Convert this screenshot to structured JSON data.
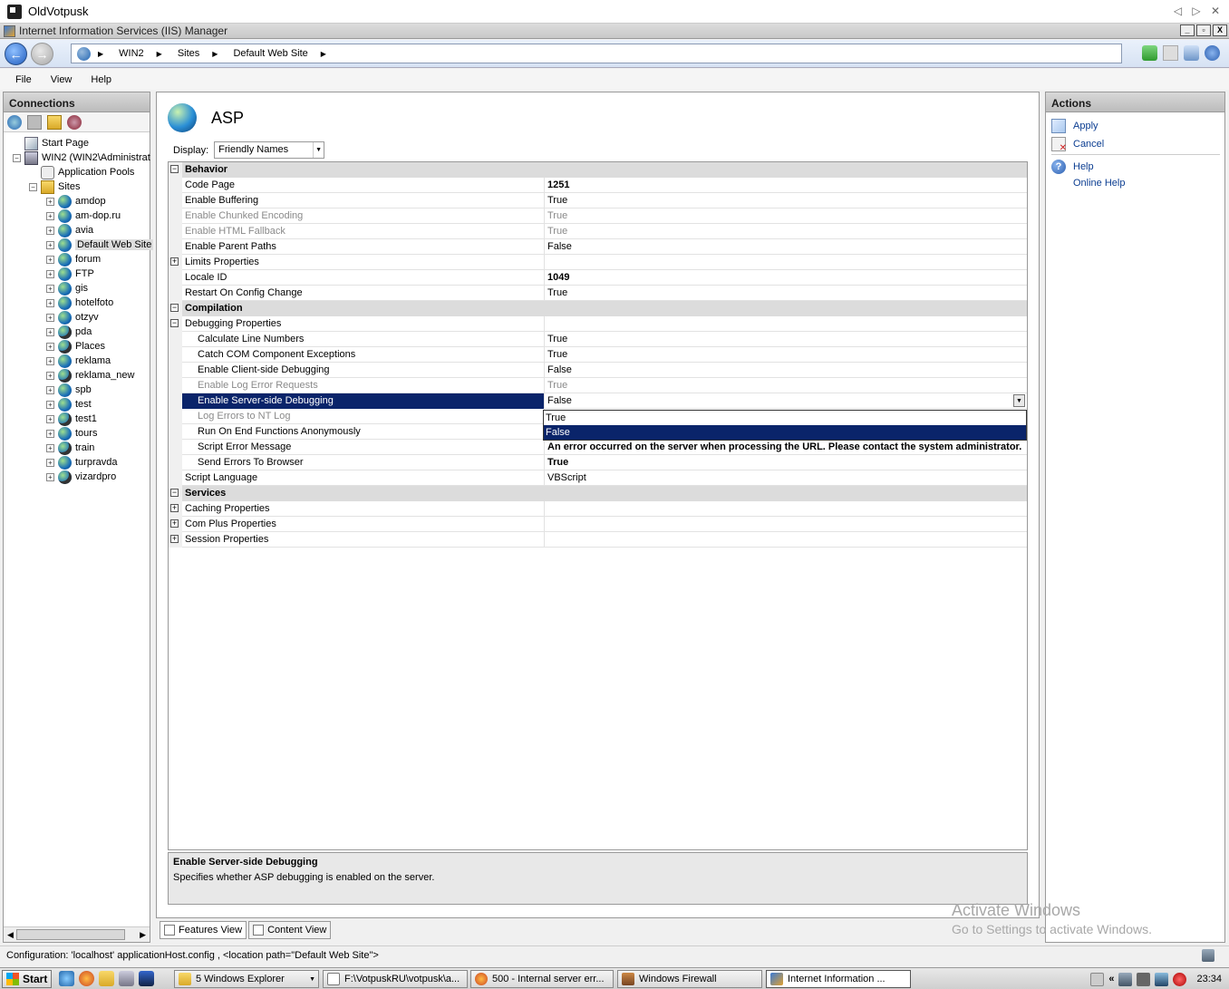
{
  "remote_session": {
    "title": "OldVotpusk",
    "controls": "◁ ▷ ✕"
  },
  "window": {
    "title": "Internet Information Services (IIS) Manager",
    "buttons": [
      "_",
      "▫",
      "X"
    ]
  },
  "address": {
    "crumbs": [
      "WIN2",
      "Sites",
      "Default Web Site"
    ]
  },
  "menu": [
    "File",
    "View",
    "Help"
  ],
  "connections": {
    "title": "Connections",
    "tree": [
      {
        "label": "Start Page",
        "level": 0,
        "toggle": "",
        "icon": "start-page-icon"
      },
      {
        "label": "WIN2 (WIN2\\Administrat",
        "level": 0,
        "toggle": "−",
        "icon": "server-icon"
      },
      {
        "label": "Application Pools",
        "level": 1,
        "toggle": "",
        "icon": "application-pools-icon"
      },
      {
        "label": "Sites",
        "level": 1,
        "toggle": "−",
        "icon": "sites-folder-icon"
      },
      {
        "label": "amdop",
        "level": 2,
        "toggle": "+",
        "icon": "site-globe-icon"
      },
      {
        "label": "am-dop.ru",
        "level": 2,
        "toggle": "+",
        "icon": "site-globe-icon"
      },
      {
        "label": "avia",
        "level": 2,
        "toggle": "+",
        "icon": "site-globe-icon"
      },
      {
        "label": "Default Web Site",
        "level": 2,
        "toggle": "+",
        "icon": "site-globe-icon",
        "selected": true
      },
      {
        "label": "forum",
        "level": 2,
        "toggle": "+",
        "icon": "site-globe-icon"
      },
      {
        "label": "FTP",
        "level": 2,
        "toggle": "+",
        "icon": "site-globe-icon"
      },
      {
        "label": "gis",
        "level": 2,
        "toggle": "+",
        "icon": "site-globe-icon"
      },
      {
        "label": "hotelfoto",
        "level": 2,
        "toggle": "+",
        "icon": "site-globe-icon"
      },
      {
        "label": "otzyv",
        "level": 2,
        "toggle": "+",
        "icon": "site-globe-icon"
      },
      {
        "label": "pda",
        "level": 2,
        "toggle": "+",
        "icon": "site-stopped-icon"
      },
      {
        "label": "Places",
        "level": 2,
        "toggle": "+",
        "icon": "site-stopped-icon"
      },
      {
        "label": "reklama",
        "level": 2,
        "toggle": "+",
        "icon": "site-globe-icon"
      },
      {
        "label": "reklama_new",
        "level": 2,
        "toggle": "+",
        "icon": "site-stopped-icon"
      },
      {
        "label": "spb",
        "level": 2,
        "toggle": "+",
        "icon": "site-globe-icon"
      },
      {
        "label": "test",
        "level": 2,
        "toggle": "+",
        "icon": "site-globe-icon"
      },
      {
        "label": "test1",
        "level": 2,
        "toggle": "+",
        "icon": "site-stopped-icon"
      },
      {
        "label": "tours",
        "level": 2,
        "toggle": "+",
        "icon": "site-globe-icon"
      },
      {
        "label": "train",
        "level": 2,
        "toggle": "+",
        "icon": "site-stopped-icon"
      },
      {
        "label": "turpravda",
        "level": 2,
        "toggle": "+",
        "icon": "site-globe-icon"
      },
      {
        "label": "vizardpro",
        "level": 2,
        "toggle": "+",
        "icon": "site-stopped-icon"
      }
    ]
  },
  "feature": {
    "title": "ASP",
    "display_label": "Display:",
    "display_value": "Friendly Names"
  },
  "grid": [
    {
      "name": "Behavior",
      "value": "",
      "type": "cat",
      "toggle": "−"
    },
    {
      "name": "Code Page",
      "value": "1251",
      "bold": true
    },
    {
      "name": "Enable Buffering",
      "value": "True"
    },
    {
      "name": "Enable Chunked Encoding",
      "value": "True",
      "ro": true
    },
    {
      "name": "Enable HTML Fallback",
      "value": "True",
      "ro": true
    },
    {
      "name": "Enable Parent Paths",
      "value": "False"
    },
    {
      "name": "Limits Properties",
      "value": "",
      "toggle": "+"
    },
    {
      "name": "Locale ID",
      "value": "1049",
      "bold": true
    },
    {
      "name": "Restart On Config Change",
      "value": "True"
    },
    {
      "name": "Compilation",
      "value": "",
      "type": "cat",
      "toggle": "−"
    },
    {
      "name": "Debugging Properties",
      "value": "",
      "toggle": "−"
    },
    {
      "name": "Calculate Line Numbers",
      "value": "True",
      "sub": true
    },
    {
      "name": "Catch COM Component Exceptions",
      "value": "True",
      "sub": true
    },
    {
      "name": "Enable Client-side Debugging",
      "value": "False",
      "sub": true
    },
    {
      "name": "Enable Log Error Requests",
      "value": "True",
      "sub": true,
      "ro": true
    },
    {
      "name": "Enable Server-side Debugging",
      "value": "False",
      "sub": true,
      "selected": true
    },
    {
      "name": "Log Errors to NT Log",
      "value": "",
      "sub": true,
      "ro": true
    },
    {
      "name": "Run On End Functions Anonymously",
      "value": "",
      "sub": true
    },
    {
      "name": "Script Error Message",
      "value": "An error occurred on the server when processing the URL. Please contact the system administrator.",
      "sub": true,
      "bold": true
    },
    {
      "name": "Send Errors To Browser",
      "value": "True",
      "sub": true,
      "bold": true
    },
    {
      "name": "Script Language",
      "value": "VBScript"
    },
    {
      "name": "Services",
      "value": "",
      "type": "cat",
      "toggle": "−"
    },
    {
      "name": "Caching Properties",
      "value": "",
      "toggle": "+"
    },
    {
      "name": "Com Plus Properties",
      "value": "",
      "toggle": "+"
    },
    {
      "name": "Session Properties",
      "value": "",
      "toggle": "+"
    }
  ],
  "dropdown_options": [
    "True",
    "False"
  ],
  "dropdown_highlighted": "False",
  "description": {
    "title": "Enable Server-side Debugging",
    "text": "Specifies whether ASP debugging is enabled on the server."
  },
  "view_tabs": {
    "features": "Features View",
    "content": "Content View"
  },
  "actions": {
    "title": "Actions",
    "apply": "Apply",
    "cancel": "Cancel",
    "help": "Help",
    "online_help": "Online Help"
  },
  "watermark": {
    "line1": "Activate Windows",
    "line2": "Go to Settings to activate Windows."
  },
  "status": {
    "text": "Configuration: 'localhost' applicationHost.config , <location path=\"Default Web Site\">"
  },
  "taskbar": {
    "start": "Start",
    "tasks": [
      "5 Windows Explorer",
      "F:\\VotpuskRU\\votpusk\\a...",
      "500 - Internal server err...",
      "Windows Firewall",
      "Internet Information ..."
    ],
    "clock": "23:34",
    "tray_chevron": "«"
  }
}
